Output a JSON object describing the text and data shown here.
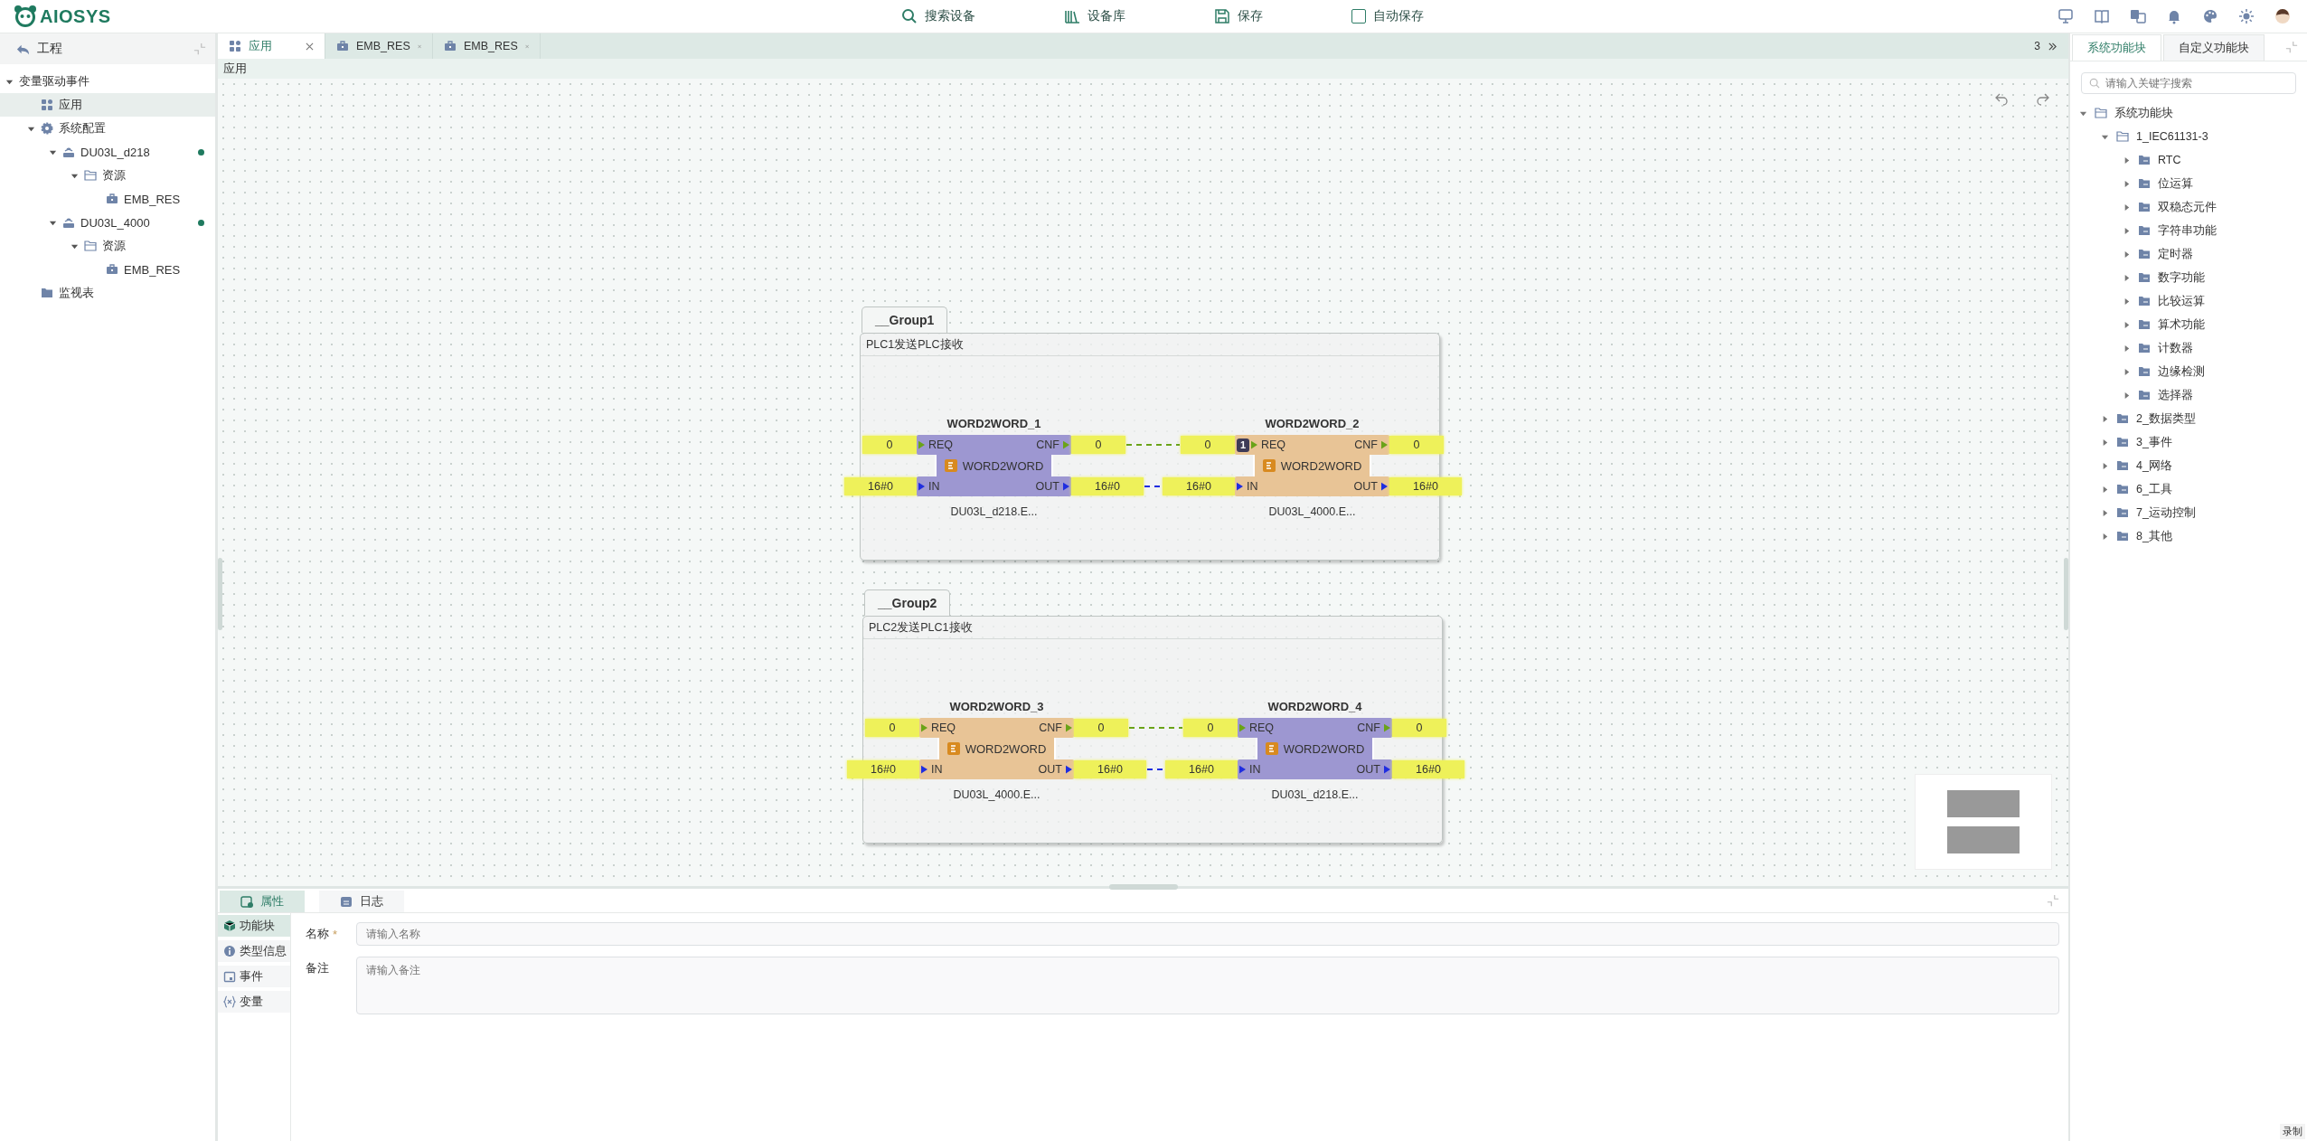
{
  "app_bar": {
    "brand": "AIOSYS",
    "toolbar": [
      {
        "kind": "search",
        "label": "搜索设备"
      },
      {
        "kind": "library",
        "label": "设备库"
      },
      {
        "kind": "save",
        "label": "保存"
      },
      {
        "kind": "checkbox",
        "label": "自动保存",
        "checked": false
      }
    ]
  },
  "project_panel": {
    "title": "工程",
    "tree": [
      {
        "label": "变量驱动事件",
        "selected": false,
        "expanded": true,
        "children": [
          {
            "label": "应用",
            "kind": "app",
            "selected": true
          },
          {
            "label": "系统配置",
            "kind": "config",
            "selected": false,
            "expanded": true,
            "children": [
              {
                "label": "DU03L_d218",
                "kind": "device",
                "selected": false,
                "online": true,
                "expanded": true,
                "children": [
                  {
                    "label": "资源",
                    "kind": "folder",
                    "selected": false,
                    "expanded": true,
                    "children": [
                      {
                        "label": "EMB_RES",
                        "kind": "resource",
                        "selected": false
                      }
                    ]
                  }
                ]
              },
              {
                "label": "DU03L_4000",
                "kind": "device",
                "selected": false,
                "online": true,
                "expanded": true,
                "children": [
                  {
                    "label": "资源",
                    "kind": "folder",
                    "selected": false,
                    "expanded": true,
                    "children": [
                      {
                        "label": "EMB_RES",
                        "kind": "resource",
                        "selected": false
                      }
                    ]
                  }
                ]
              }
            ]
          },
          {
            "label": "监视表",
            "kind": "watch",
            "selected": false
          }
        ]
      }
    ]
  },
  "editor": {
    "tabs": [
      {
        "label": "应用",
        "kind": "app",
        "selected": true
      },
      {
        "label": "EMB_RES",
        "kind": "resource",
        "selected": false
      },
      {
        "label": "EMB_RES",
        "kind": "resource",
        "selected": false
      }
    ],
    "tab_count": "3",
    "breadcrumb": "应用",
    "groups": [
      {
        "title": "__Group1",
        "comment": "PLC1发送PLC接收",
        "blocks": [
          {
            "name": "WORD2WORD_1",
            "type": "WORD2WORD",
            "resource": "DU03L_d218.E...",
            "color": "#9d97d1",
            "inputs": [
              {
                "name": "REQ",
                "kind": "event",
                "value": "0"
              },
              {
                "name": "IN",
                "kind": "data",
                "value": "16#0"
              }
            ],
            "outputs": [
              {
                "name": "CNF",
                "kind": "event",
                "value": "0"
              },
              {
                "name": "OUT",
                "kind": "data",
                "value": "16#0"
              }
            ]
          },
          {
            "name": "WORD2WORD_2",
            "type": "WORD2WORD",
            "resource": "DU03L_4000.E...",
            "color": "#e8c496",
            "badge": "1",
            "inputs": [
              {
                "name": "REQ",
                "kind": "event",
                "value": "0"
              },
              {
                "name": "IN",
                "kind": "data",
                "value": "16#0"
              }
            ],
            "outputs": [
              {
                "name": "CNF",
                "kind": "event",
                "value": "0"
              },
              {
                "name": "OUT",
                "kind": "data",
                "value": "16#0"
              }
            ]
          }
        ]
      },
      {
        "title": "__Group2",
        "comment": "PLC2发送PLC1接收",
        "blocks": [
          {
            "name": "WORD2WORD_3",
            "type": "WORD2WORD",
            "resource": "DU03L_4000.E...",
            "color": "#e8c496",
            "inputs": [
              {
                "name": "REQ",
                "kind": "event",
                "value": "0"
              },
              {
                "name": "IN",
                "kind": "data",
                "value": "16#0"
              }
            ],
            "outputs": [
              {
                "name": "CNF",
                "kind": "event",
                "value": "0"
              },
              {
                "name": "OUT",
                "kind": "data",
                "value": "16#0"
              }
            ]
          },
          {
            "name": "WORD2WORD_4",
            "type": "WORD2WORD",
            "resource": "DU03L_d218.E...",
            "color": "#9d97d1",
            "inputs": [
              {
                "name": "REQ",
                "kind": "event",
                "value": "0"
              },
              {
                "name": "IN",
                "kind": "data",
                "value": "16#0"
              }
            ],
            "outputs": [
              {
                "name": "CNF",
                "kind": "event",
                "value": "0"
              },
              {
                "name": "OUT",
                "kind": "data",
                "value": "16#0"
              }
            ]
          }
        ]
      }
    ]
  },
  "library_panel": {
    "tabs": [
      {
        "label": "系统功能块",
        "selected": true
      },
      {
        "label": "自定义功能块",
        "selected": false
      }
    ],
    "search": {
      "placeholder": "请输入关键字搜索"
    },
    "tree": [
      {
        "label": "系统功能块",
        "expanded": true,
        "children": [
          {
            "label": "1_IEC61131-3",
            "expanded": true,
            "children": [
              {
                "label": "RTC",
                "expanded": false
              },
              {
                "label": "位运算",
                "expanded": false
              },
              {
                "label": "双稳态元件",
                "expanded": false
              },
              {
                "label": "字符串功能",
                "expanded": false
              },
              {
                "label": "定时器",
                "expanded": false
              },
              {
                "label": "数字功能",
                "expanded": false
              },
              {
                "label": "比较运算",
                "expanded": false
              },
              {
                "label": "算术功能",
                "expanded": false
              },
              {
                "label": "计数器",
                "expanded": false
              },
              {
                "label": "边缘检测",
                "expanded": false
              },
              {
                "label": "选择器",
                "expanded": false
              }
            ]
          },
          {
            "label": "2_数据类型",
            "expanded": false
          },
          {
            "label": "3_事件",
            "expanded": false
          },
          {
            "label": "4_网络",
            "expanded": false
          },
          {
            "label": "6_工具",
            "expanded": false
          },
          {
            "label": "7_运动控制",
            "expanded": false
          },
          {
            "label": "8_其他",
            "expanded": false
          }
        ]
      }
    ]
  },
  "bottom_panel": {
    "tabs": [
      {
        "kind": "properties",
        "label": "属性",
        "selected": true
      },
      {
        "kind": "log",
        "label": "日志",
        "selected": false
      }
    ],
    "nav": [
      {
        "kind": "block",
        "label": "功能块",
        "selected": true
      },
      {
        "kind": "info",
        "label": "类型信息",
        "selected": false
      },
      {
        "kind": "event",
        "label": "事件",
        "selected": false
      },
      {
        "kind": "variable",
        "label": "变量",
        "selected": false
      }
    ],
    "fields": [
      {
        "kind": "input",
        "label": "名称",
        "required_mark": "*",
        "placeholder": "请输入名称"
      },
      {
        "kind": "textarea",
        "label": "备注",
        "placeholder": "请输入备注"
      }
    ]
  },
  "status": {
    "label": "录制"
  }
}
